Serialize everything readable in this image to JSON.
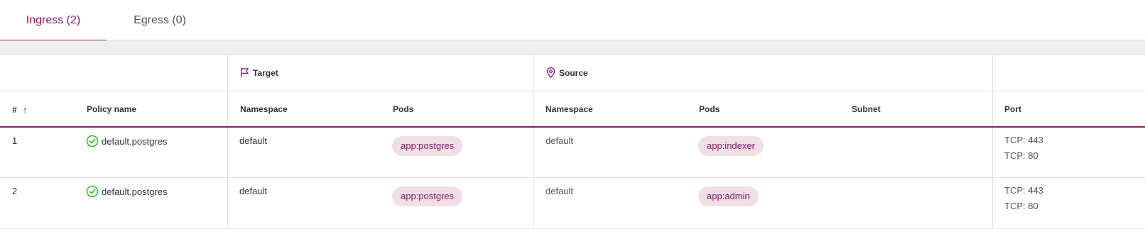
{
  "tabs": [
    {
      "label": "Ingress (2)",
      "active": true
    },
    {
      "label": "Egress (0)",
      "active": false
    }
  ],
  "groups": {
    "target": {
      "label": "Target",
      "icon": "flag-icon"
    },
    "source": {
      "label": "Source",
      "icon": "location-pin-icon"
    }
  },
  "columns": {
    "index": "#",
    "policy_name": "Policy name",
    "target_namespace": "Namespace",
    "target_pods": "Pods",
    "source_namespace": "Namespace",
    "source_pods": "Pods",
    "subnet": "Subnet",
    "port": "Port"
  },
  "rows": [
    {
      "index": "1",
      "policy_name": "default.postgres",
      "status_icon": "check-circle-icon",
      "target_namespace": "default",
      "target_pod": "app:postgres",
      "source_namespace": "default",
      "source_pod": "app:indexer",
      "subnet": "",
      "ports": [
        "TCP: 443",
        "TCP: 80"
      ]
    },
    {
      "index": "2",
      "policy_name": "default.postgres",
      "status_icon": "check-circle-icon",
      "target_namespace": "default",
      "target_pod": "app:postgres",
      "source_namespace": "default",
      "source_pod": "app:admin",
      "subnet": "",
      "ports": [
        "TCP: 443",
        "TCP: 80"
      ]
    }
  ],
  "colors": {
    "accent": "#8a1a6b",
    "tag_bg": "#f1dfe7",
    "success": "#2eb82e"
  }
}
